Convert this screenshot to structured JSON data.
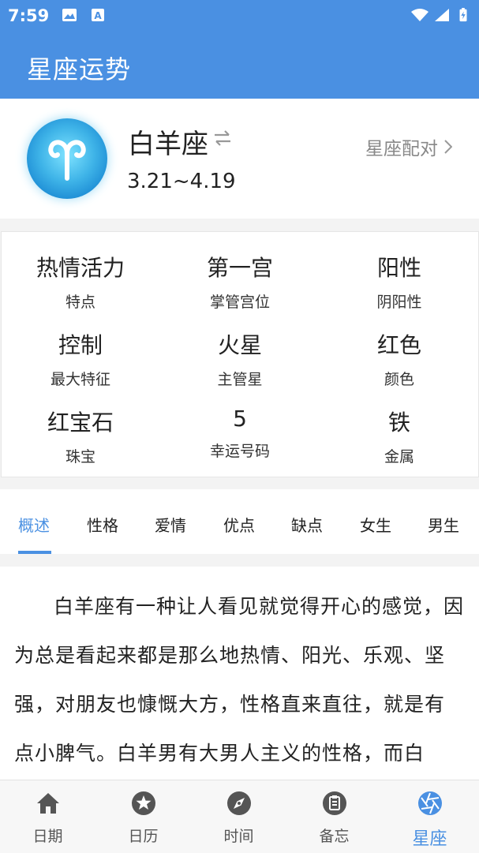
{
  "status_bar": {
    "time": "7:59"
  },
  "app_bar": {
    "title": "星座运势"
  },
  "sign": {
    "name": "白羊座",
    "dates": "3.21~4.19",
    "match_link": "星座配对"
  },
  "attributes": [
    {
      "value": "热情活力",
      "label": "特点"
    },
    {
      "value": "第一宫",
      "label": "掌管宫位"
    },
    {
      "value": "阳性",
      "label": "阴阳性"
    },
    {
      "value": "控制",
      "label": "最大特征"
    },
    {
      "value": "火星",
      "label": "主管星"
    },
    {
      "value": "红色",
      "label": "颜色"
    },
    {
      "value": "红宝石",
      "label": "珠宝"
    },
    {
      "value": "5",
      "label": "幸运号码"
    },
    {
      "value": "铁",
      "label": "金属"
    }
  ],
  "tabs": [
    "概述",
    "性格",
    "爱情",
    "优点",
    "缺点",
    "女生",
    "男生"
  ],
  "active_tab": "概述",
  "content": {
    "text": "白羊座有一种让人看见就觉得开心的感觉，因为总是看起来都是那么地热情、阳光、乐观、坚强，对朋友也慷慨大方，性格直来直往，就是有点小脾气。白羊男有大男人主义的性格，而白"
  },
  "bottom_nav": [
    {
      "label": "日期",
      "icon": "home-icon"
    },
    {
      "label": "日历",
      "icon": "star-icon"
    },
    {
      "label": "时间",
      "icon": "compass-icon"
    },
    {
      "label": "备忘",
      "icon": "clipboard-icon"
    },
    {
      "label": "星座",
      "icon": "aperture-icon"
    }
  ],
  "colors": {
    "primary": "#4a90e2",
    "text": "#222222",
    "muted": "#888888"
  }
}
